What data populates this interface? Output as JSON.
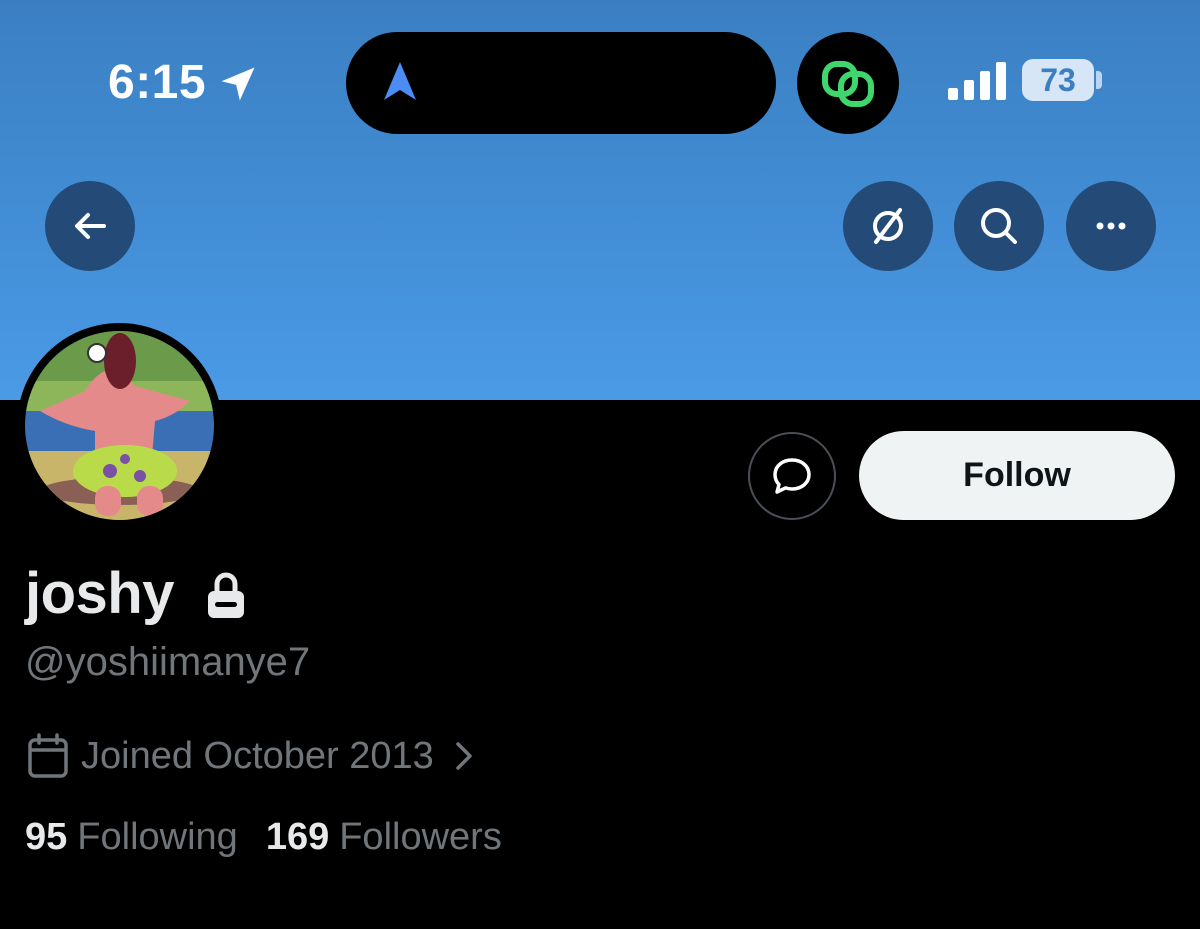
{
  "status_bar": {
    "time": "6:15",
    "battery": "73",
    "icons": [
      "location-arrow-icon",
      "navigation-icon",
      "link-app-icon",
      "signal-bars-icon",
      "battery-icon"
    ]
  },
  "header": {
    "buttons": [
      "back-arrow-icon",
      "grok-icon",
      "search-icon",
      "more-icon"
    ]
  },
  "profile": {
    "display_name": "joshy",
    "handle": "@yoshiimanye7",
    "joined": "Joined October 2013",
    "following_count": "95",
    "following_label": "Following",
    "followers_count": "169",
    "followers_label": "Followers"
  },
  "actions": {
    "follow_label": "Follow"
  },
  "colors": {
    "banner": "#418bd2",
    "header_button": "#244b78",
    "follow_bg": "#eff3f4",
    "muted_text": "#71767b",
    "primary_text": "#e7e9ea"
  }
}
